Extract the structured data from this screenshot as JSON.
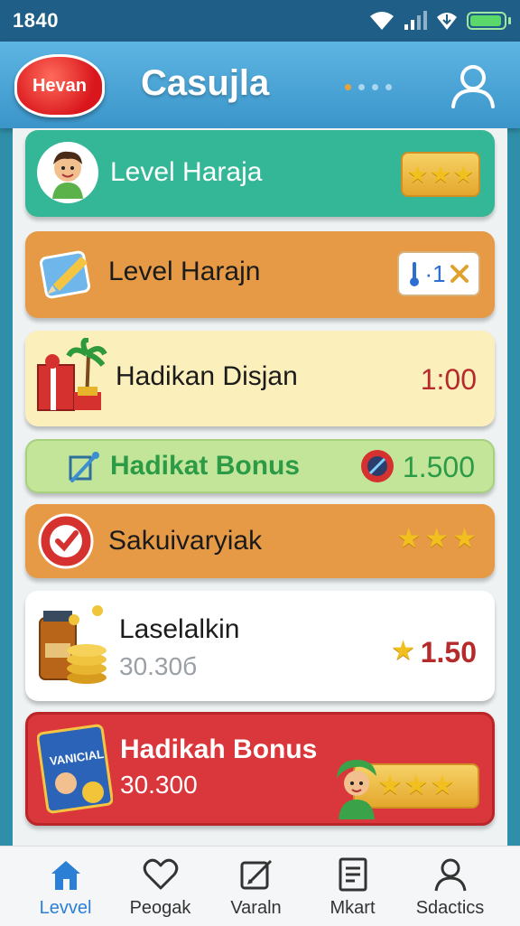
{
  "status_bar": {
    "time": "1840"
  },
  "header": {
    "logo_text": "Hevan",
    "title": "Casujla"
  },
  "cards": [
    {
      "label": "Level Haraja",
      "badge": "stars-badge",
      "stars": 3,
      "icon": "avatar-boy"
    },
    {
      "label": "Level Harajn",
      "badge_text": "·1",
      "icon": "pencil-card-icon"
    },
    {
      "label": "Hadikan Disjan",
      "value": "1:00",
      "icon": "gift-palm-icon"
    },
    {
      "label": "Hadikat Bonus",
      "value": "1.500",
      "icon": "pen-icon",
      "extra_icon": "compass-icon"
    },
    {
      "label": "Sakuivaryiak",
      "stars": 3,
      "icon": "check-circle-icon"
    },
    {
      "label": "Laselalkin",
      "sublabel": "30.30б",
      "value": "1.50",
      "stars": 1,
      "icon": "coins-jar-icon"
    },
    {
      "label": "Hadikah Bonus",
      "sublabel": "30.300",
      "card_text": "VANICIAL",
      "stars": 3,
      "icon": "avatar-girl"
    }
  ],
  "nav": [
    {
      "label": "Levvel",
      "icon": "home-icon",
      "active": true
    },
    {
      "label": "Peogak",
      "icon": "heart-icon",
      "active": false
    },
    {
      "label": "Varaln",
      "icon": "edit-icon",
      "active": false
    },
    {
      "label": "Mkart",
      "icon": "document-icon",
      "active": false
    },
    {
      "label": "Sdactics",
      "icon": "person-icon",
      "active": false
    }
  ],
  "colors": {
    "status_bar": "#1f5e86",
    "header": "#4aa6d7",
    "accent_blue": "#2b7fd4",
    "card_green": "#34b796",
    "card_orange": "#e69a46",
    "card_cream": "#fbefbb",
    "card_lime": "#c3e59a",
    "card_red": "#d9373b"
  }
}
